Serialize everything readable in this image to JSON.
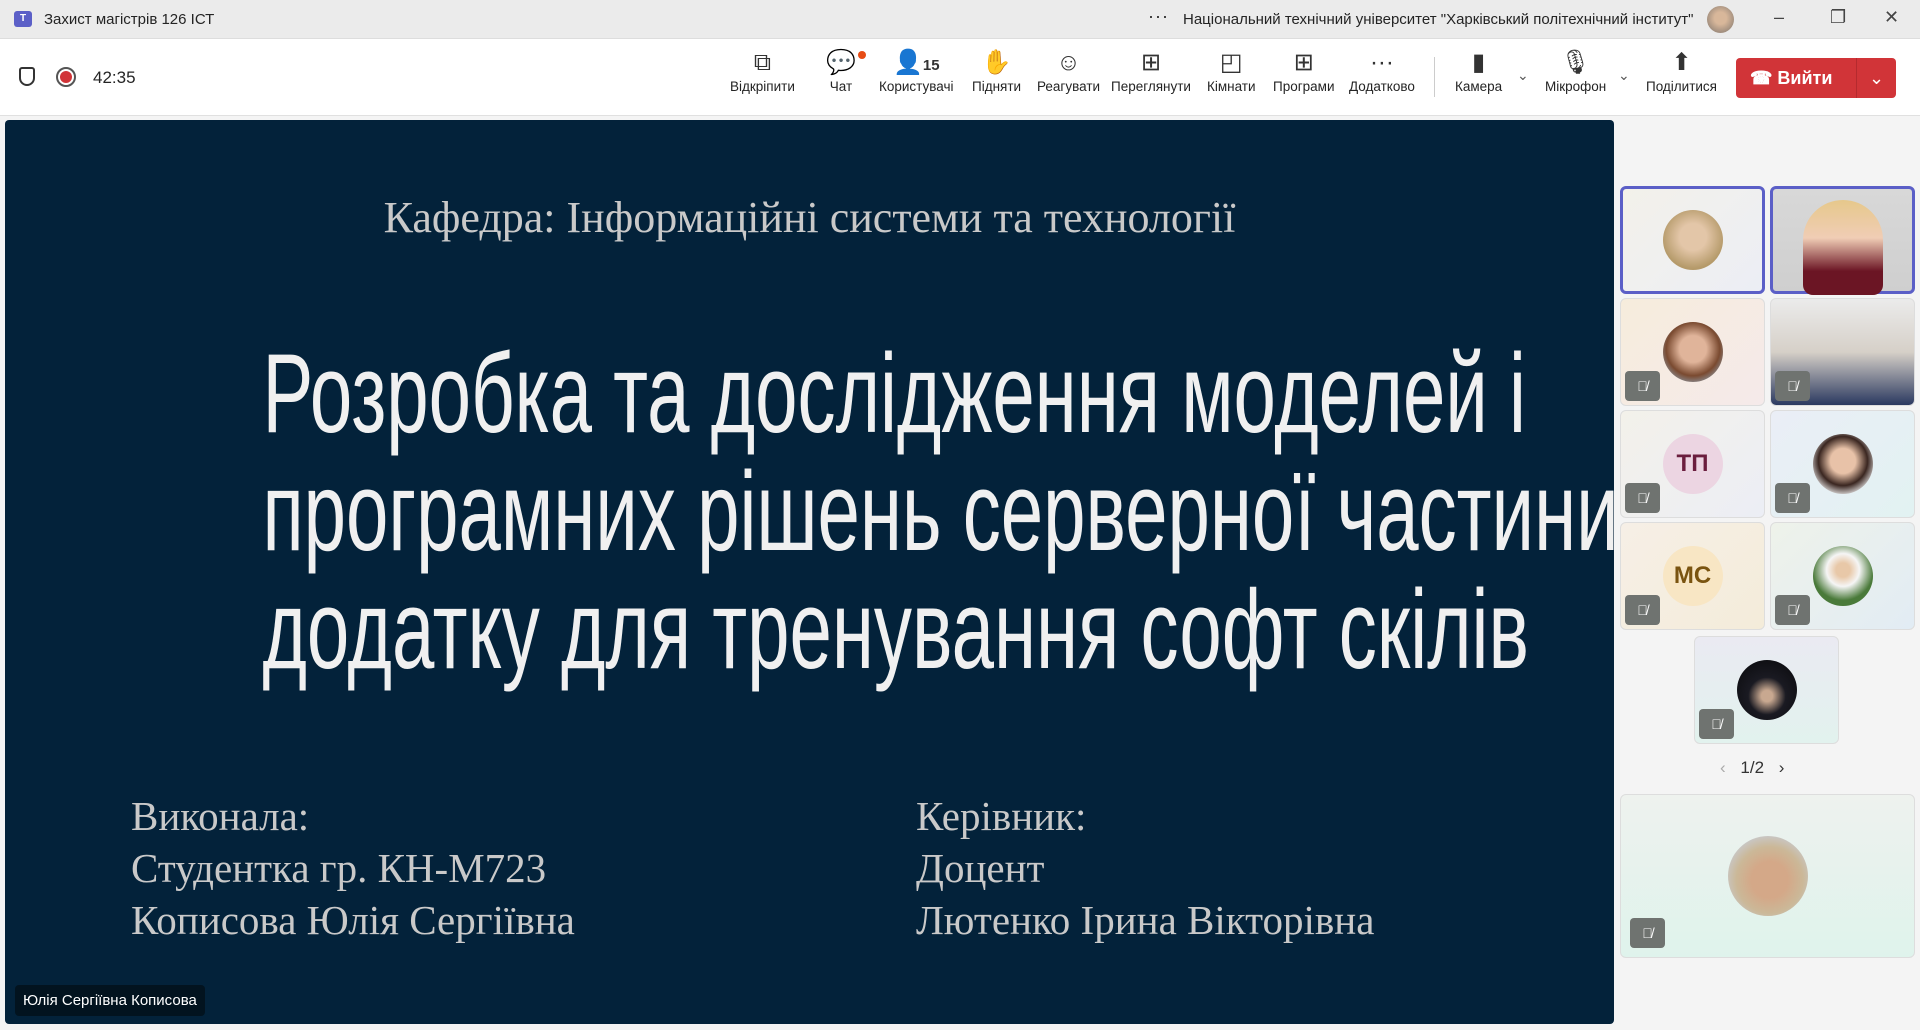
{
  "window": {
    "title": "Захист магістрів 126 ІСТ",
    "org": "Національний технічний університет \"Харківський політехнічний інститут\"",
    "more": "···",
    "minimize": "–",
    "restore": "❐",
    "close": "✕"
  },
  "toolbar": {
    "timer": "42:35",
    "participants_count": "15",
    "buttons": [
      {
        "label": "Відкріпити",
        "icon": "⧉"
      },
      {
        "label": "Чат",
        "icon": "💬"
      },
      {
        "label": "Користувачі",
        "icon": "👤"
      },
      {
        "label": "Підняти",
        "icon": "✋"
      },
      {
        "label": "Реагувати",
        "icon": "☺"
      },
      {
        "label": "Переглянути",
        "icon": "⊞"
      },
      {
        "label": "Кімнати",
        "icon": "◰"
      },
      {
        "label": "Програми",
        "icon": "⊞"
      },
      {
        "label": "Додатково",
        "icon": "···"
      },
      {
        "label": "Камера",
        "icon": "▮"
      },
      {
        "label": "Мікрофон",
        "icon": "🎙"
      },
      {
        "label": "Поділитися",
        "icon": "⬆"
      }
    ],
    "leave_label": "Вийти"
  },
  "slide": {
    "department": "Кафедра: Інформаційні системи та технології",
    "title_lines": [
      "Розробка та дослідження моделей і",
      "програмних рішень серверної частини",
      "додатку для тренування софт скілів"
    ],
    "left": [
      "Виконала:",
      "Студентка гр. КН-М723",
      "Кописова Юлія Сергіївна"
    ],
    "right": [
      "Керівник:",
      "Доцент",
      "Лютенко Ірина Вікторівна"
    ]
  },
  "presenter_name": "Юлія Сергіївна Кописова",
  "participants": {
    "initials_1": "ТП",
    "initials_2": "МС",
    "page": "1/2"
  }
}
